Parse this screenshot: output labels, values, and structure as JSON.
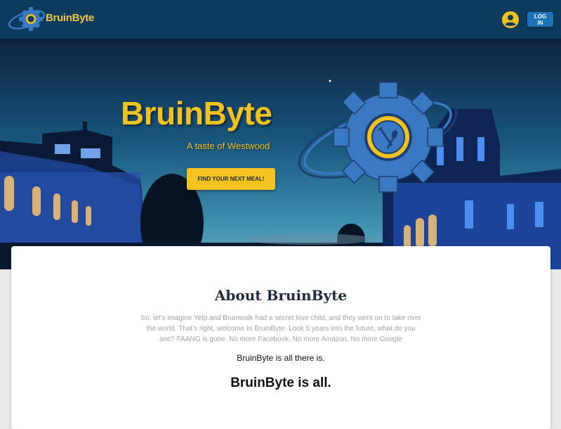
{
  "nav": {
    "brand": "BruinByte",
    "login_label": "LOG IN"
  },
  "hero": {
    "title": "BruinByte",
    "subtitle": "A taste of Westwood",
    "cta_label": "FIND YOUR NEXT MEAL!"
  },
  "about": {
    "title": "About BruinByte",
    "body": "So, let's imagine Yelp and Bruinwalk had a secret love child, and they went on to take over the world. That's right, welcome to BruinByte. Look 5 years into the future, what do you see? FAANG is gone. No more Facebook. No more Amazon. No more Google",
    "line1": "BruinByte is all there is.",
    "line2": "BruinByte is all."
  },
  "icons": {
    "nav_logo": "gear-orbit-logo-icon",
    "account": "account-circle-icon",
    "hero_logo": "gear-fork-spoon-logo-icon"
  },
  "colors": {
    "navbar": "#0d3b5e",
    "accent_gold": "#f4c21f",
    "login_button": "#1e73b9",
    "logo_blue": "#3a78c2"
  }
}
